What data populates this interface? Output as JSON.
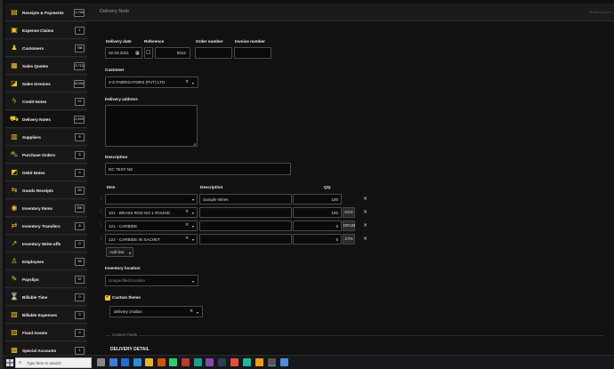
{
  "sidebar": {
    "items": [
      {
        "icon": "receipt-icon",
        "glyph": "▤",
        "label": "Receipts & Payments",
        "badge": "1,736"
      },
      {
        "icon": "expense-icon",
        "glyph": "▣",
        "label": "Expense Claims",
        "badge": "1"
      },
      {
        "icon": "customers-icon",
        "glyph": "♟",
        "label": "Customers",
        "badge": "788"
      },
      {
        "icon": "quote-icon",
        "glyph": "▦",
        "label": "Sales Quotes",
        "badge": "3,713"
      },
      {
        "icon": "invoice-icon",
        "glyph": "◪",
        "label": "Sales Invoices",
        "badge": "6,033"
      },
      {
        "icon": "credit-icon",
        "glyph": "ϟ",
        "label": "Credit Notes",
        "badge": "37"
      },
      {
        "icon": "truck-icon",
        "glyph": "⛟",
        "label": "Delivery Notes",
        "badge": "2,929"
      },
      {
        "icon": "suppliers-icon",
        "glyph": "▥",
        "label": "Suppliers",
        "badge": "6"
      },
      {
        "icon": "cart-icon",
        "glyph": "⛍",
        "label": "Purchase Orders",
        "badge": "5"
      },
      {
        "icon": "debit-icon",
        "glyph": "◩",
        "label": "Debit Notes",
        "badge": "0"
      },
      {
        "icon": "goods-receipt-icon",
        "glyph": "⇆",
        "label": "Goods Receipts",
        "badge": "39"
      },
      {
        "icon": "inventory-items-icon",
        "glyph": "◉",
        "label": "Inventory Items",
        "badge": "990"
      },
      {
        "icon": "inventory-transfer-icon",
        "glyph": "⇄",
        "label": "Inventory Transfers",
        "badge": "8"
      },
      {
        "icon": "write-off-icon",
        "glyph": "↗",
        "label": "Inventory Write-offs",
        "badge": "0"
      },
      {
        "icon": "employees-icon",
        "glyph": "♙",
        "label": "Employees",
        "badge": "35"
      },
      {
        "icon": "payslip-icon",
        "glyph": "✎",
        "label": "Payslips",
        "badge": "37"
      },
      {
        "icon": "hourglass-icon",
        "glyph": "⌛",
        "label": "Billable Time",
        "badge": "0"
      },
      {
        "icon": "billable-expenses-icon",
        "glyph": "▧",
        "label": "Billable Expenses",
        "badge": "0"
      },
      {
        "icon": "fixed-assets-icon",
        "glyph": "▨",
        "label": "Fixed Assets",
        "badge": "0"
      },
      {
        "icon": "special-accounts-icon",
        "glyph": "▩",
        "label": "Special Accounts",
        "badge": "1"
      }
    ]
  },
  "header": {
    "title": "Delivery Note",
    "right": "Wm4e112/acc"
  },
  "form": {
    "delivery_date_label": "Delivery date",
    "delivery_date_value": "02.03.2021",
    "reference_label": "Reference",
    "reference_value": "5012",
    "order_number_label": "Order number",
    "order_number_value": "",
    "invoice_number_label": "Invoice number",
    "invoice_number_value": "",
    "customer_label": "Customer",
    "customer_value": "3-S FABRICATORS (PVT) LTD",
    "delivery_address_label": "Delivery address",
    "delivery_address_value": "",
    "description_label": "Description",
    "description_value": "DC TEST NZ",
    "lines_header": {
      "item": "Item",
      "description": "Description",
      "qty": "Qty"
    },
    "lines": [
      {
        "item": "",
        "description": "Sample Wires",
        "qty": "100",
        "unit": ""
      },
      {
        "item": "101 - BRASS ROD NO 1 ROUND",
        "description": "",
        "qty": "100",
        "unit": "KGS"
      },
      {
        "item": "121 - CARBIDE",
        "description": "",
        "qty": "5",
        "unit": "DRUM"
      },
      {
        "item": "122 - CARBIDE IN SACHET",
        "description": "",
        "qty": "5",
        "unit": "CTN"
      }
    ],
    "add_line_label": "Add line",
    "inventory_location_label": "Inventory location",
    "inventory_location_placeholder": "Unspecified location",
    "custom_theme_label": "Custom theme",
    "custom_theme_value": "delivery challan",
    "custom_fields_label": "Custom Fields",
    "delivery_detail_label": "DELIVERY DETAIL"
  },
  "taskbar": {
    "search_placeholder": "Type here to search"
  },
  "colors": {
    "accent": "#f5c518",
    "background": "#111111",
    "sidebar": "#1d1d1d"
  }
}
